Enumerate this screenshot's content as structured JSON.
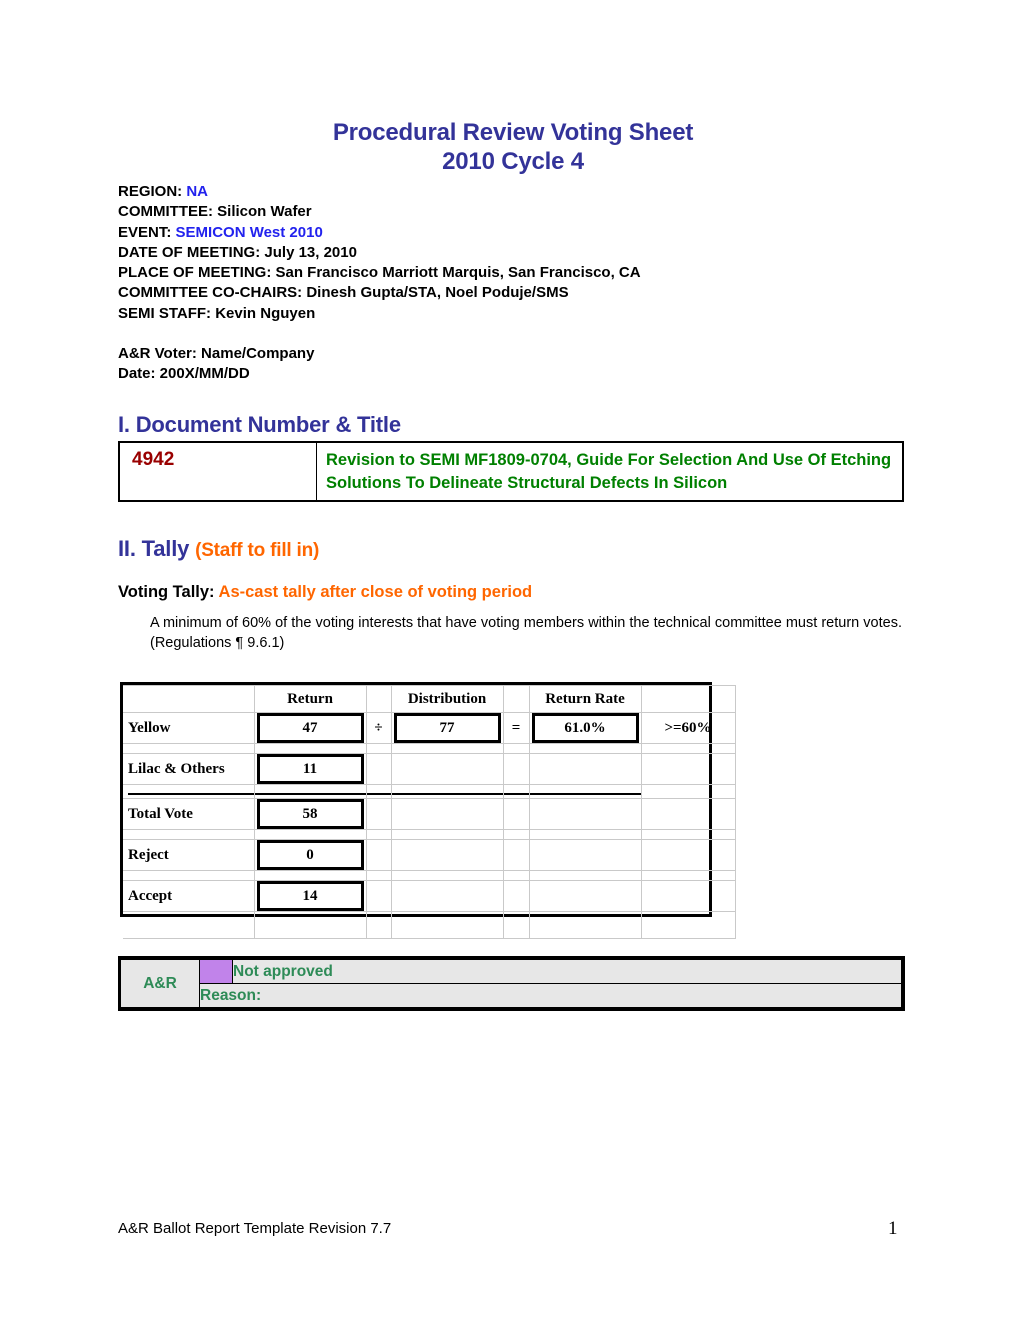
{
  "document": {
    "title_line1": "Procedural Review Voting Sheet",
    "title_line2": "2010 Cycle 4"
  },
  "meta": {
    "region_label": "REGION: ",
    "region_value": "NA",
    "committee_label": "COMMITTEE: ",
    "committee_value": "Silicon Wafer",
    "event_label": "EVENT: ",
    "event_value": "SEMICON West 2010",
    "date_of_meeting_label": "DATE OF MEETING: ",
    "date_of_meeting_value": "July 13, 2010",
    "place_of_meeting_label": "PLACE OF MEETING: ",
    "place_of_meeting_value": "San Francisco Marriott Marquis, San Francisco, CA",
    "cochairs_label": "COMMITTEE CO-CHAIRS: ",
    "cochairs_value": "Dinesh Gupta/STA, Noel Poduje/SMS",
    "semi_staff_label": "SEMI STAFF: ",
    "semi_staff_value": "Kevin Nguyen"
  },
  "voter": {
    "voter_line": "A&R Voter: Name/Company",
    "date_line": "Date: 200X/MM/DD"
  },
  "section1": {
    "heading": "I. Document Number & Title",
    "document_number": "4942",
    "document_title": "Revision to SEMI MF1809-0704, Guide For Selection And Use Of Etching Solutions To Delineate Structural Defects In Silicon"
  },
  "section2": {
    "heading": "II. Tally ",
    "heading_suffix": "(Staff to fill in)",
    "voting_tally_label": "Voting Tally: ",
    "voting_tally_value": "As-cast tally after close of voting period",
    "regulation_note": "A minimum of 60% of the voting interests that have voting members within the technical committee must return votes. (Regulations ¶ 9.6.1)"
  },
  "tally_table": {
    "headers": {
      "return": "Return",
      "distribution": "Distribution",
      "return_rate": "Return Rate"
    },
    "operators": {
      "divide": "÷",
      "equals": "="
    },
    "rows": {
      "yellow": {
        "label": "Yellow",
        "return": "47",
        "distribution": "77",
        "return_rate": "61.0%",
        "threshold": ">=60%"
      },
      "lilac_others": {
        "label": "Lilac & Others",
        "return": "11"
      },
      "total_vote": {
        "label": "Total Vote",
        "return": "58"
      },
      "reject": {
        "label": "Reject",
        "return": "0"
      },
      "accept": {
        "label": "Accept",
        "return": "14"
      }
    }
  },
  "ar_block": {
    "label": "A&R",
    "status": "Not approved",
    "reason_label": "Reason:",
    "swatch_color": "#c183ea"
  },
  "footer": {
    "template_text": "A&R Ballot Report Template Revision 7.7",
    "page_number": "1"
  },
  "colors": {
    "heading_blue": "#333399",
    "value_blue": "#2222EE",
    "doc_number_red": "#990000",
    "doc_title_green": "#008000",
    "accent_orange": "#FF6600",
    "ar_green": "#2e8b57",
    "ar_background": "#e7e7e7"
  }
}
